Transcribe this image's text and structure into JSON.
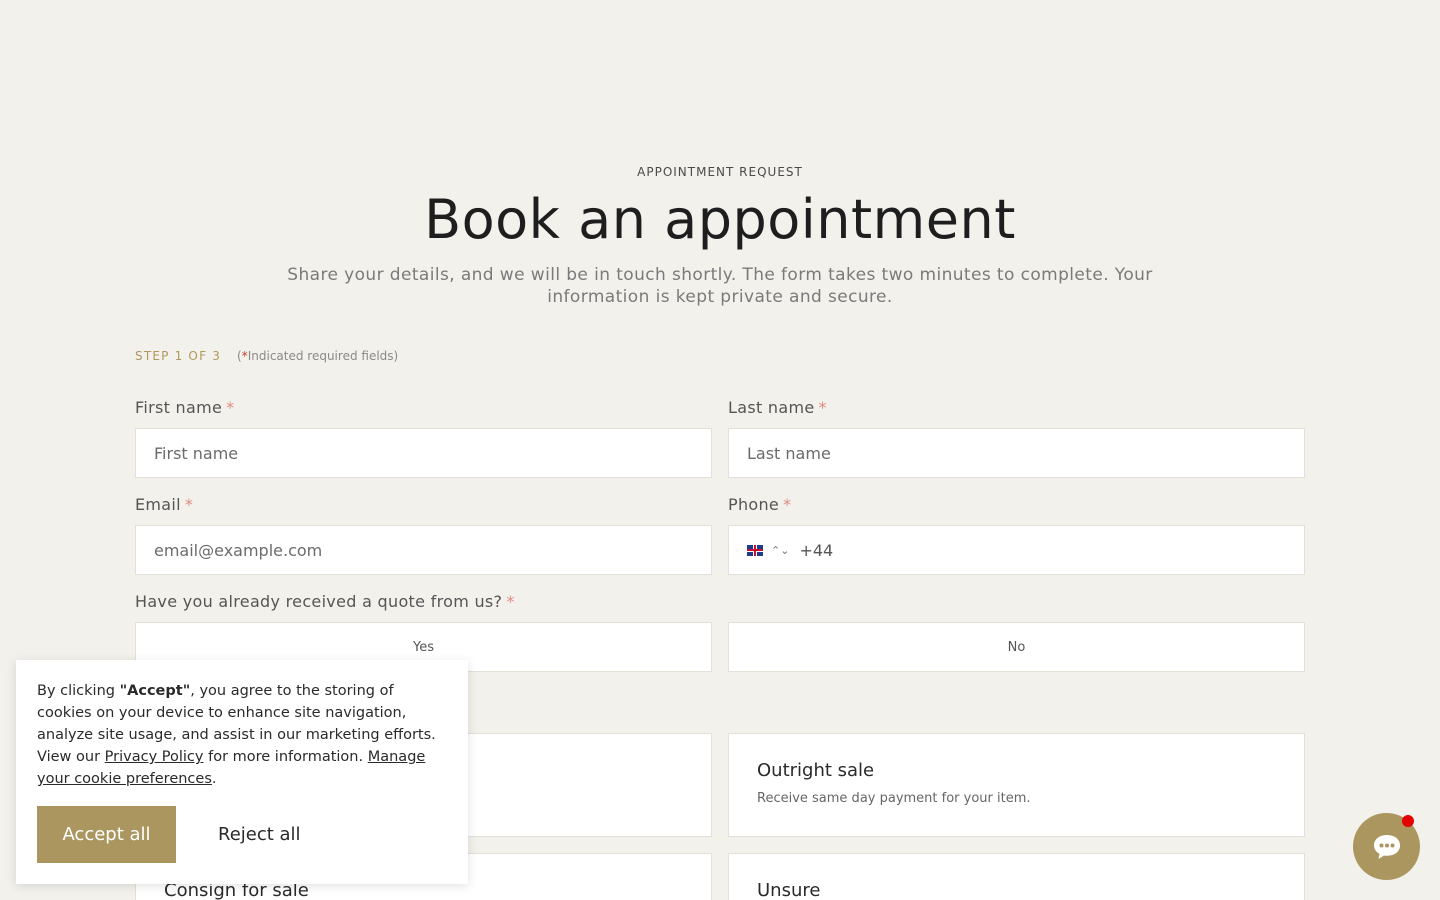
{
  "header": {
    "eyebrow": "APPOINTMENT REQUEST",
    "title": "Book an appointment",
    "subtitle": "Share your details, and we will be in touch shortly. The form takes two minutes to complete. Your information is kept private and secure."
  },
  "form": {
    "step": "STEP 1 OF 3",
    "required_note_prefix": "(",
    "required_note_star": "*",
    "required_note_suffix": "Indicated required fields)",
    "required_star": "*",
    "first_name": {
      "label": "First name",
      "placeholder": "First name"
    },
    "last_name": {
      "label": "Last name",
      "placeholder": "Last name"
    },
    "email": {
      "label": "Email",
      "placeholder": "email@example.com"
    },
    "phone": {
      "label": "Phone",
      "country_flag": "uk-flag-icon",
      "code": "+44"
    },
    "quote_question": {
      "label": "Have you already received a quote from us?",
      "options": [
        "Yes",
        "No"
      ]
    },
    "sale_options": [
      {
        "title": "Outright sale",
        "description": "Receive same day payment for your item."
      },
      {
        "title": "Consign for sale",
        "description": ""
      },
      {
        "title": "Unsure",
        "description": ""
      }
    ]
  },
  "cookie_banner": {
    "text_1": "By clicking ",
    "text_accept": "\"Accept\"",
    "text_2": ", you agree to the storing of cookies on your device to enhance site navigation, analyze site usage, and assist in our marketing efforts. View our ",
    "privacy_link": "Privacy Policy",
    "text_3": " for more information. ",
    "manage_link": "Manage your cookie preferences",
    "text_4": ".",
    "accept_label": "Accept all",
    "reject_label": "Reject all"
  },
  "chat": {
    "icon": "chat-bubble-icon",
    "notification_color": "#e30000"
  },
  "colors": {
    "accent": "#ab9660",
    "background": "#f3f1ec",
    "required": "#e08a7e"
  }
}
